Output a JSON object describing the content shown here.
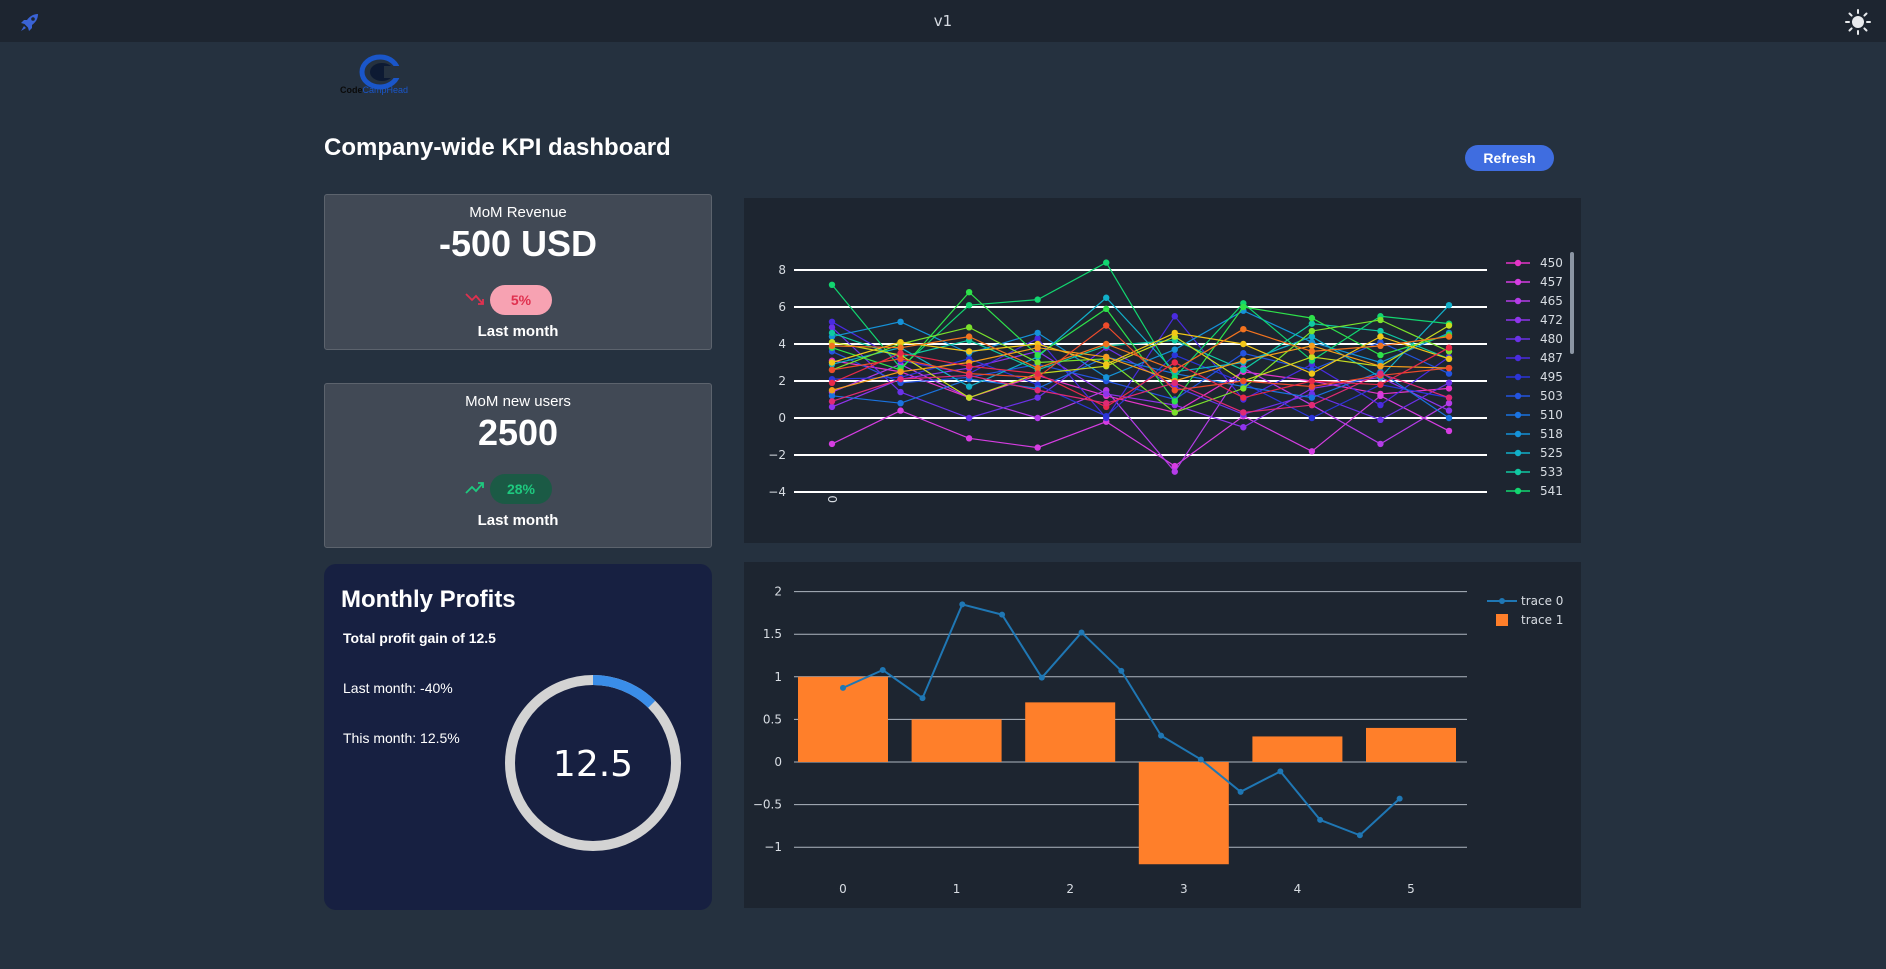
{
  "topbar": {
    "version": "v1",
    "icons": {
      "left": "rocket-icon",
      "right": "sun-icon"
    }
  },
  "logo": {
    "text_part1": "Code",
    "text_part2": "CampHead"
  },
  "page": {
    "title": "Company-wide KPI dashboard",
    "refresh_label": "Refresh"
  },
  "kpis": [
    {
      "title": "MoM Revenue",
      "value": "-500 USD",
      "badge": "5%",
      "trend": "down",
      "badge_bg": "#f7a2b2",
      "badge_fg": "#e0314f",
      "sub": "Last month"
    },
    {
      "title": "MoM new users",
      "value": "2500",
      "badge": "28%",
      "trend": "up",
      "badge_bg": "#1b5a45",
      "badge_fg": "#1ec97f",
      "sub": "Last month"
    }
  ],
  "profits": {
    "title": "Monthly Profits",
    "total": "Total profit gain of 12.5",
    "last_month": "Last month: -40%",
    "this_month": "This month: 12.5%",
    "gauge_value": "12.5",
    "gauge_fraction": 0.125,
    "gauge_colors": {
      "track": "#d3d3d3",
      "fill": "#3a8de8"
    }
  },
  "colors": {
    "accent": "#3f6de0",
    "bar": "#ff7f2a",
    "line": "#1f77b4"
  },
  "chart_data": [
    {
      "type": "line",
      "title": "",
      "x_tick_labels": [
        "0"
      ],
      "ylim": [
        -4,
        8
      ],
      "y_ticks": [
        "8",
        "6",
        "4",
        "2",
        "0",
        "−2",
        "−4"
      ],
      "grid": true,
      "legend_position": "right",
      "legend_visible": [
        "450",
        "457",
        "465",
        "472",
        "480",
        "487",
        "495",
        "503",
        "510",
        "518",
        "525",
        "533",
        "541"
      ],
      "series": [
        {
          "name": "450",
          "color": "#e535c8",
          "values": [
            3.1,
            2.5,
            1.1,
            2.3,
            1.2,
            0.3,
            2.5,
            2.0,
            1.3,
            1.6
          ]
        },
        {
          "name": "457",
          "color": "#d63de2",
          "values": [
            -1.4,
            0.4,
            -1.1,
            -1.6,
            -0.2,
            -2.6,
            0.1,
            -1.8,
            1.2,
            -0.7
          ]
        },
        {
          "name": "465",
          "color": "#b53ce8",
          "values": [
            1.4,
            2.9,
            1.1,
            0.0,
            1.5,
            -2.9,
            2.7,
            0.7,
            -1.4,
            0.8
          ]
        },
        {
          "name": "472",
          "color": "#8f34ec",
          "values": [
            0.6,
            2.1,
            2.7,
            3.6,
            1.3,
            0.7,
            -0.5,
            1.6,
            2.2,
            0.4
          ]
        },
        {
          "name": "480",
          "color": "#6b31e8",
          "values": [
            4.9,
            1.4,
            0.0,
            1.1,
            3.8,
            1.7,
            0.2,
            1.3,
            -0.1,
            1.9
          ]
        },
        {
          "name": "487",
          "color": "#4a2be0",
          "values": [
            5.2,
            3.1,
            2.4,
            4.3,
            0.0,
            5.5,
            1.0,
            2.9,
            0.7,
            3.3
          ]
        },
        {
          "name": "495",
          "color": "#2b35d9",
          "values": [
            2.1,
            2.2,
            3.2,
            1.8,
            0.1,
            3.4,
            1.9,
            0.0,
            1.8,
            1.1
          ]
        },
        {
          "name": "503",
          "color": "#2354e0",
          "values": [
            3.6,
            1.9,
            2.2,
            2.9,
            2.0,
            1.0,
            3.5,
            2.6,
            4.1,
            2.4
          ]
        },
        {
          "name": "510",
          "color": "#1a73e0",
          "values": [
            1.2,
            0.8,
            2.1,
            1.6,
            3.3,
            2.4,
            1.7,
            1.1,
            2.5,
            0.0
          ]
        },
        {
          "name": "518",
          "color": "#1592d8",
          "values": [
            4.4,
            5.2,
            3.5,
            4.6,
            2.2,
            3.7,
            5.8,
            4.1,
            3.0,
            4.6
          ]
        },
        {
          "name": "525",
          "color": "#11b0c9",
          "values": [
            2.9,
            3.8,
            1.7,
            3.3,
            6.5,
            2.5,
            3.0,
            4.4,
            2.2,
            6.1
          ]
        },
        {
          "name": "533",
          "color": "#10c9a2",
          "values": [
            4.6,
            3.3,
            4.2,
            2.6,
            3.9,
            4.2,
            2.6,
            5.1,
            4.7,
            3.2
          ]
        },
        {
          "name": "541",
          "color": "#12d670",
          "values": [
            7.2,
            2.7,
            6.1,
            6.4,
            8.4,
            2.2,
            6.2,
            3.1,
            5.5,
            5.1
          ]
        },
        {
          "name": "",
          "color": "#2ee24a",
          "values": [
            3.8,
            2.6,
            6.8,
            3.4,
            5.9,
            0.9,
            6.0,
            5.4,
            3.4,
            4.5
          ]
        },
        {
          "name": "",
          "color": "#7be22b",
          "values": [
            2.6,
            4.0,
            4.9,
            3.0,
            3.2,
            0.3,
            1.6,
            4.7,
            5.3,
            3.6
          ]
        },
        {
          "name": "",
          "color": "#c6dd20",
          "values": [
            4.1,
            3.4,
            1.1,
            2.4,
            2.8,
            4.4,
            2.0,
            3.3,
            2.8,
            5.0
          ]
        },
        {
          "name": "",
          "color": "#f2c718",
          "values": [
            3.0,
            4.1,
            3.6,
            4.0,
            2.9,
            4.6,
            4.0,
            2.4,
            4.4,
            3.2
          ]
        },
        {
          "name": "",
          "color": "#f59d1c",
          "values": [
            1.5,
            2.5,
            3.0,
            3.8,
            3.3,
            2.0,
            3.1,
            3.9,
            2.8,
            2.7
          ]
        },
        {
          "name": "",
          "color": "#f2731f",
          "values": [
            3.9,
            3.8,
            4.4,
            2.7,
            4.0,
            2.6,
            4.8,
            3.6,
            3.9,
            4.4
          ]
        },
        {
          "name": "",
          "color": "#ee4b2b",
          "values": [
            2.6,
            3.2,
            2.4,
            2.2,
            5.0,
            1.5,
            2.0,
            1.7,
            2.3,
            2.7
          ]
        },
        {
          "name": "",
          "color": "#e8294a",
          "values": [
            1.9,
            3.5,
            2.8,
            2.4,
            0.6,
            3.0,
            1.1,
            2.0,
            1.8,
            3.8
          ]
        },
        {
          "name": "",
          "color": "#e02a75",
          "values": [
            0.9,
            2.1,
            2.3,
            1.5,
            0.8,
            1.9,
            0.3,
            0.7,
            2.4,
            1.1
          ]
        }
      ]
    },
    {
      "type": "bar",
      "title": "",
      "categories": [
        "0",
        "1",
        "2",
        "3",
        "4",
        "5"
      ],
      "ylim": [
        -1.2,
        2.1
      ],
      "y_ticks": [
        2,
        1.5,
        1,
        0.5,
        0,
        -0.5,
        -1
      ],
      "y_tick_labels": [
        "2",
        "1.5",
        "1",
        "0.5",
        "0",
        "−0.5",
        "−1"
      ],
      "grid": true,
      "legend_position": "top-right",
      "series": [
        {
          "name": "trace 0",
          "type": "line",
          "x": [
            0,
            0.35,
            0.7,
            1.05,
            1.4,
            1.75,
            2.1,
            2.45,
            2.8,
            3.15,
            3.5,
            3.85,
            4.2,
            4.55,
            4.9
          ],
          "values": [
            0.87,
            1.08,
            0.75,
            1.85,
            1.73,
            0.99,
            1.52,
            1.07,
            0.31,
            0.03,
            -0.35,
            -0.11,
            -0.68,
            -0.86,
            -0.43
          ]
        },
        {
          "name": "trace 1",
          "type": "bar",
          "values": [
            1.0,
            0.5,
            0.7,
            -1.2,
            0.3,
            0.4
          ]
        }
      ]
    }
  ]
}
